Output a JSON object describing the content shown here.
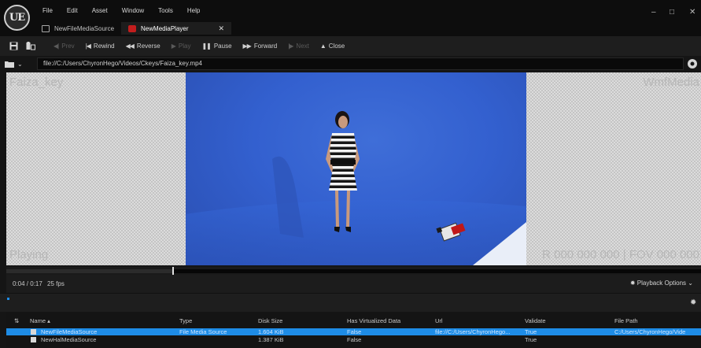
{
  "menubar": {
    "items": [
      "File",
      "Edit",
      "Asset",
      "Window",
      "Tools",
      "Help"
    ]
  },
  "logo": {
    "text": "UE"
  },
  "tabs": [
    {
      "label": "NewFileMediaSource",
      "icon": "media-source-icon",
      "active": false
    },
    {
      "label": "NewMediaPlayer",
      "icon": "media-player-icon",
      "active": true
    }
  ],
  "window_controls": {
    "minimize": "–",
    "maximize": "□",
    "close": "✕"
  },
  "toolbar": {
    "buttons": [
      {
        "label": "Prev",
        "glyph": "◀|",
        "enabled": false
      },
      {
        "label": "Rewind",
        "glyph": "|◀",
        "enabled": true
      },
      {
        "label": "Reverse",
        "glyph": "◀◀",
        "enabled": true
      },
      {
        "label": "Play",
        "glyph": "▶",
        "enabled": false
      },
      {
        "label": "Pause",
        "glyph": "❚❚",
        "enabled": true
      },
      {
        "label": "Forward",
        "glyph": "▶▶",
        "enabled": true
      },
      {
        "label": "Next",
        "glyph": "|▶",
        "enabled": false
      },
      {
        "label": "Close",
        "glyph": "▲",
        "enabled": true
      }
    ]
  },
  "url_bar": {
    "value": "file://C:/Users/ChyronHego/Videos/Ckeys/Faiza_key.mp4"
  },
  "viewport": {
    "media_name": "Faiza_key",
    "player_name": "WmfMedia",
    "state": "Playing",
    "rotation_fov": "R 000 000 000 | FOV 000 000"
  },
  "timeline": {
    "progress_fraction": 0.24
  },
  "status": {
    "time": "0:04 / 0:17",
    "fps": "25 fps",
    "playback_options": "Playback Options"
  },
  "content_browser": {
    "columns": [
      "Name",
      "Type",
      "Disk Size",
      "Has Virtualized Data",
      "Url",
      "Validate",
      "File Path"
    ],
    "rows": [
      {
        "name": "NewFileMediaSource",
        "type": "File Media Source",
        "disk_size": "1.604 KiB",
        "virtualized": "False",
        "url": "file://C:/Users/ChyronHego...",
        "validate": "True",
        "path": "C:/Users/ChyronHego/Vide",
        "selected": true
      },
      {
        "name": "NewHalMediaSource",
        "type": "",
        "disk_size": "1.387 KiB",
        "virtualized": "False",
        "url": "",
        "validate": "True",
        "path": "",
        "selected": false
      }
    ]
  },
  "colors": {
    "selection": "#1e8ce6",
    "player_tab_icon": "#c21d1d",
    "video_background": "#3360cf"
  }
}
